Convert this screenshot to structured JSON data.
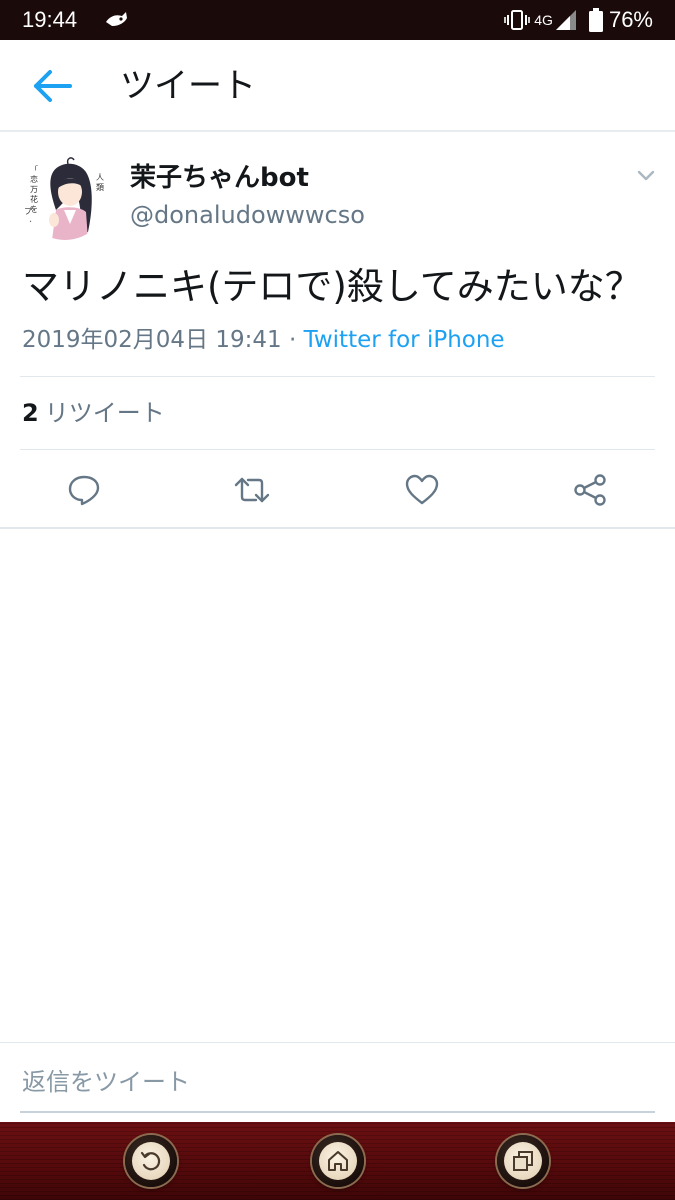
{
  "status_bar": {
    "time": "19:44",
    "network_type": "4G",
    "battery_percent": "76%",
    "icons": [
      "app-notification-icon",
      "vibrate-icon",
      "signal-icon",
      "battery-icon"
    ]
  },
  "header": {
    "title": "ツイート",
    "back_icon": "back-arrow-icon"
  },
  "tweet": {
    "display_name": "茉子ちゃんbot",
    "handle": "@donaludowwwcso",
    "avatar_text": "「恋ノ花をプレイ」人類",
    "text": "マリノニキ(テロで)殺してみたいな？",
    "timestamp": "2019年02月04日 19:41",
    "separator": " · ",
    "source": "Twitter for iPhone",
    "retweet_count": "2",
    "retweet_label": "リツイート"
  },
  "actions": [
    {
      "name": "reply-icon"
    },
    {
      "name": "retweet-icon"
    },
    {
      "name": "like-icon"
    },
    {
      "name": "share-icon"
    }
  ],
  "reply": {
    "placeholder": "返信をツイート"
  },
  "nav": {
    "buttons": [
      "back-nav-icon",
      "home-nav-icon",
      "recents-nav-icon"
    ]
  },
  "colors": {
    "accent": "#1da1f2",
    "secondary_text": "#657786",
    "primary_text": "#14171a",
    "nav_background": "#5a0b0d"
  }
}
